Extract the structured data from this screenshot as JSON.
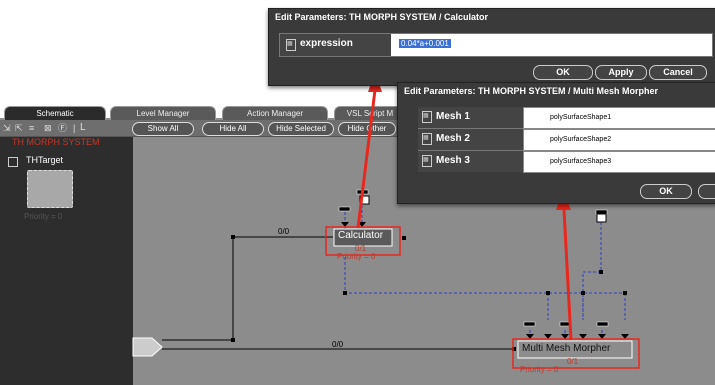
{
  "tabs": [
    {
      "label": "Schematic"
    },
    {
      "label": "Level Manager"
    },
    {
      "label": "Action Manager"
    },
    {
      "label": "VSL Script M"
    }
  ],
  "toolbar": {
    "show_all": "Show All",
    "hide_all": "Hide All",
    "hide_selected": "Hide Selected",
    "hide_other": "Hide Other",
    "layout_icon": "L"
  },
  "left_panel": {
    "system_name": "TH MORPH SYSTEM",
    "target_label": "THTarget",
    "target_priority": "Priority = 0"
  },
  "calc_dialog": {
    "title": "Edit Parameters: TH MORPH SYSTEM / Calculator",
    "param_label": "expression",
    "param_value": "0.04*a+0.001",
    "ok": "OK",
    "apply": "Apply",
    "cancel": "Cancel"
  },
  "mesh_dialog": {
    "title": "Edit Parameters: TH MORPH SYSTEM / Multi Mesh Morpher",
    "rows": [
      {
        "label": "Mesh 1",
        "value": "polySurfaceShape1"
      },
      {
        "label": "Mesh 2",
        "value": "polySurfaceShape2"
      },
      {
        "label": "Mesh 3",
        "value": "polySurfaceShape3"
      }
    ],
    "ok": "OK"
  },
  "schematic": {
    "calc_node_label": "Calculator",
    "calc_node_io": "0/1",
    "calc_node_priority": "Priority = 0",
    "morpher_node_label": "Multi Mesh Morpher",
    "morpher_node_io": "0/1",
    "morpher_node_priority": "Priority = 0",
    "wire_label_top": "0/0",
    "wire_label_bottom": "0/0"
  },
  "colors": {
    "annotation_red": "#e8281e",
    "dialog_bg": "#3a3a3a",
    "schematic_bg": "#8c8c8c"
  }
}
